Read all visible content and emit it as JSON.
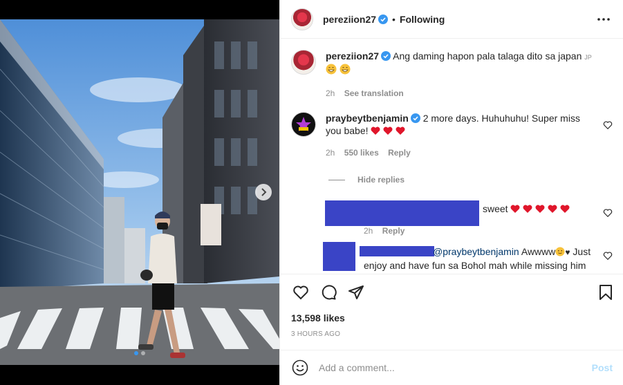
{
  "post": {
    "photo_alt": "",
    "carousel": {
      "count": 2,
      "active": 0
    }
  },
  "header": {
    "username": "pereziion27",
    "separator": "•",
    "follow_status": "Following"
  },
  "caption": {
    "username": "pereziion27",
    "text": "Ang daming hapon pala talaga dito sa japan",
    "flag": "JP",
    "time": "2h",
    "see_translation": "See translation"
  },
  "comment1": {
    "username": "praybeytbenjamin",
    "text": "2 more days. Huhuhuhu! Super miss you babe!",
    "time": "2h",
    "likes": "550 likes",
    "reply": "Reply"
  },
  "hide_replies": "Hide replies",
  "reply1": {
    "text": "sweet",
    "time": "2h",
    "reply": "Reply"
  },
  "reply2": {
    "mention": "@praybeytbenjamin",
    "text_before": "Awwww",
    "text_after": "Just enjoy and have fun sa Bohol mah while missing him so"
  },
  "actions": {
    "likes": "13,598 likes",
    "time_ago": "3 HOURS AGO"
  },
  "add_comment": {
    "placeholder": "Add a comment...",
    "post_label": "Post"
  },
  "colors": {
    "verified": "#3897f0",
    "redaction": "#3a44c6",
    "link": "#00376b",
    "post_disabled": "#b2dffc",
    "heart": "#ed4956"
  },
  "icons": [
    "chevron-right-icon",
    "more-icon",
    "verified-icon",
    "heart-icon",
    "comment-icon",
    "share-icon",
    "bookmark-icon",
    "smile-icon",
    "heart-emoji-icon",
    "grin-emoji-icon"
  ]
}
